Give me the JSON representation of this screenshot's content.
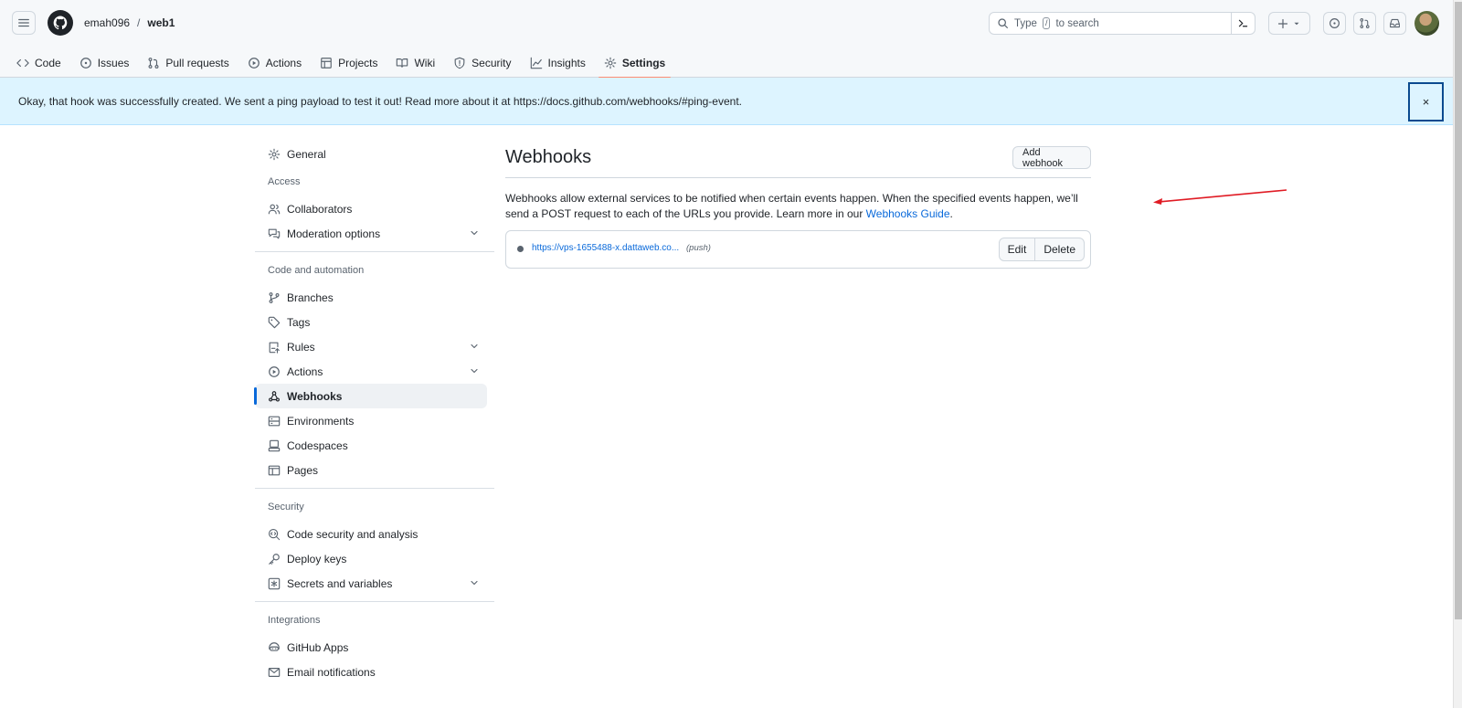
{
  "header": {
    "owner": "emah096",
    "separator": "/",
    "repo": "web1",
    "search_prefix": "Type",
    "search_key": "/",
    "search_suffix": "to search"
  },
  "nav": {
    "items": [
      {
        "label": "Code",
        "icon": "code-icon"
      },
      {
        "label": "Issues",
        "icon": "issue-icon"
      },
      {
        "label": "Pull requests",
        "icon": "pull-request-icon"
      },
      {
        "label": "Actions",
        "icon": "play-icon"
      },
      {
        "label": "Projects",
        "icon": "table-icon"
      },
      {
        "label": "Wiki",
        "icon": "book-icon"
      },
      {
        "label": "Security",
        "icon": "shield-icon"
      },
      {
        "label": "Insights",
        "icon": "graph-icon"
      },
      {
        "label": "Settings",
        "icon": "gear-icon"
      }
    ],
    "active": "Settings"
  },
  "flash": {
    "message": "Okay, that hook was successfully created. We sent a ping payload to test it out! Read more about it at https://docs.github.com/webhooks/#ping-event.",
    "close": "×"
  },
  "sidebar": {
    "general": "General",
    "access_heading": "Access",
    "collaborators": "Collaborators",
    "moderation": "Moderation options",
    "code_heading": "Code and automation",
    "branches": "Branches",
    "tags": "Tags",
    "rules": "Rules",
    "actions": "Actions",
    "webhooks": "Webhooks",
    "environments": "Environments",
    "codespaces": "Codespaces",
    "pages": "Pages",
    "security_heading": "Security",
    "code_security": "Code security and analysis",
    "deploy_keys": "Deploy keys",
    "secrets": "Secrets and variables",
    "integrations_heading": "Integrations",
    "github_apps": "GitHub Apps",
    "email_notifications": "Email notifications"
  },
  "main": {
    "title": "Webhooks",
    "add_button": "Add webhook",
    "desc_text": "Webhooks allow external services to be notified when certain events happen. When the specified events happen, we’ll send a POST request to each of the URLs you provide. Learn more in our ",
    "desc_link": "Webhooks Guide",
    "desc_end": ".",
    "hook": {
      "url": "https://vps-1655488-x.dattaweb.co...",
      "event": "(push)",
      "edit": "Edit",
      "delete": "Delete"
    }
  },
  "colors": {
    "accent": "#0969da",
    "active_tab_underline": "#fd8c73",
    "flash_bg": "#ddf4ff",
    "annotation": "#e01b24"
  }
}
